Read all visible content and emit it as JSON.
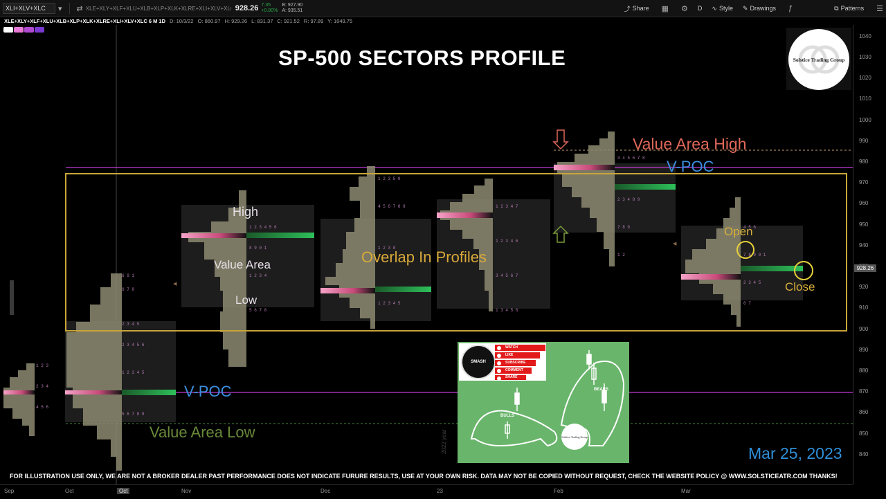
{
  "toolbar": {
    "symbol": "XLI+XLV+XLC",
    "compare_symbols": "XLE+XLY+XLF+XLU+XLB+XLP+XLK+XLRE+XLI+XLV+XLC",
    "last_price": "928.26",
    "change": "7.35",
    "change_pct": "+0.80%",
    "bid": "B: 927.90",
    "ask": "A: 935.51",
    "share_label": "Share",
    "interval_label": "D",
    "style_label": "Style",
    "drawings_label": "Drawings",
    "patterns_label": "Patterns"
  },
  "infobar": {
    "study": "XLE+XLY+XLF+XLU+XLB+XLP+XLK+XLRE+XLI+XLV+XLC 6 M 1D",
    "date": "D: 10/3/22",
    "open": "O: 860.97",
    "high": "H: 929.26",
    "low": "L: 831.37",
    "close": "C: 921.52",
    "range": "R: 97.89",
    "y": "Y: 1049.75"
  },
  "chart": {
    "title": "SP-500 SECTORS PROFILE",
    "annotations": {
      "high": "High",
      "value_area": "Value Area",
      "low": "Low",
      "overlap": "Overlap In Profiles",
      "value_area_high": "Value Area High",
      "vpoc_top": "V-POC",
      "vpoc_bottom": "V-POC",
      "value_area_low": "Value Area Low",
      "open": "Open",
      "close": "Close"
    },
    "date_stamp": "Mar 25, 2023",
    "disclaimer": "FOR ILLUSTRATION USE ONLY, WE ARE NOT A BROKER DEALER PAST PERFORMANCE DOES NOT INDICATE FURURE RESULTS, USE AT YOUR OWN RISK. DATA MAY NOT BE COPIED WITHOUT REQUEST, CHECK THE WEBSITE POLICY @ WWW.SOLSTICEATR.COM THANKS!",
    "year_watermark": "2022 year"
  },
  "logo": {
    "text": "Solstice Trading Group"
  },
  "promo": {
    "button_text": "SMASH",
    "items": [
      "WATCH",
      "LIKE",
      "SUBSCRIBE",
      "COMMENT",
      "SHARE"
    ],
    "bulls": "BULLS",
    "bears": "BEARS",
    "mini_logo": "Solstice Trading Group"
  },
  "price_axis": {
    "ticks": [
      "1040",
      "1030",
      "1020",
      "1010",
      "1000",
      "990",
      "980",
      "970",
      "960",
      "950",
      "940",
      "930",
      "920",
      "910",
      "900",
      "890",
      "880",
      "870",
      "860",
      "850",
      "840"
    ],
    "last_tag": "928.26"
  },
  "time_axis": {
    "labels": [
      "Sep",
      "Oct",
      "Oct",
      "Nov",
      "Dec",
      "23",
      "Feb",
      "Mar"
    ]
  },
  "colors": {
    "accent_gold": "#c9a53a",
    "vpoc_line": "#c43ad6",
    "value_area_high": "#e0685a",
    "value_area_low": "#7a9a3a",
    "vpoc_text": "#3b8fe0"
  }
}
